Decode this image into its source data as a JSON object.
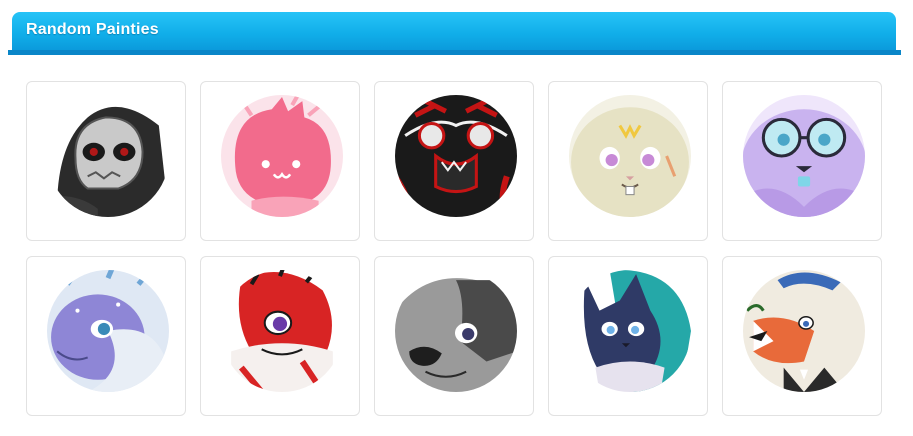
{
  "panel": {
    "title": "Random Painties",
    "accent": "#11aee9",
    "accent_dark": "#0a86c8"
  },
  "gallery": {
    "items": [
      {
        "icon": "skull-mask-creature-avatar",
        "palette": [
          "#2a2a2a",
          "#bdbdbd",
          "#b01818"
        ]
      },
      {
        "icon": "pink-cat-avatar",
        "palette": [
          "#f26b8c",
          "#ffffff",
          "#f9a3b8"
        ]
      },
      {
        "icon": "red-black-creature-avatar",
        "palette": [
          "#1a1a1a",
          "#c41414",
          "#f2f2f2"
        ]
      },
      {
        "icon": "cream-bunny-avatar",
        "palette": [
          "#e6e2c4",
          "#c78ad6",
          "#f0c840"
        ]
      },
      {
        "icon": "purple-glasses-creature-avatar",
        "palette": [
          "#b89ae6",
          "#7fd6e8",
          "#2a2a3a"
        ]
      },
      {
        "icon": "blue-purple-dragon-avatar",
        "palette": [
          "#8e86d6",
          "#e8eef6",
          "#6fa6d6"
        ]
      },
      {
        "icon": "red-white-creature-avatar",
        "palette": [
          "#d82424",
          "#ffffff",
          "#6a3aa8"
        ]
      },
      {
        "icon": "grey-dog-avatar",
        "palette": [
          "#9a9a9a",
          "#4a4a4a",
          "#ffffff"
        ]
      },
      {
        "icon": "navy-wolf-teal-avatar",
        "palette": [
          "#2f3a66",
          "#25a8a8",
          "#6fb2e8"
        ]
      },
      {
        "icon": "fox-suit-avatar",
        "palette": [
          "#f0ebe0",
          "#e86a3a",
          "#3a6ab8"
        ]
      }
    ]
  }
}
